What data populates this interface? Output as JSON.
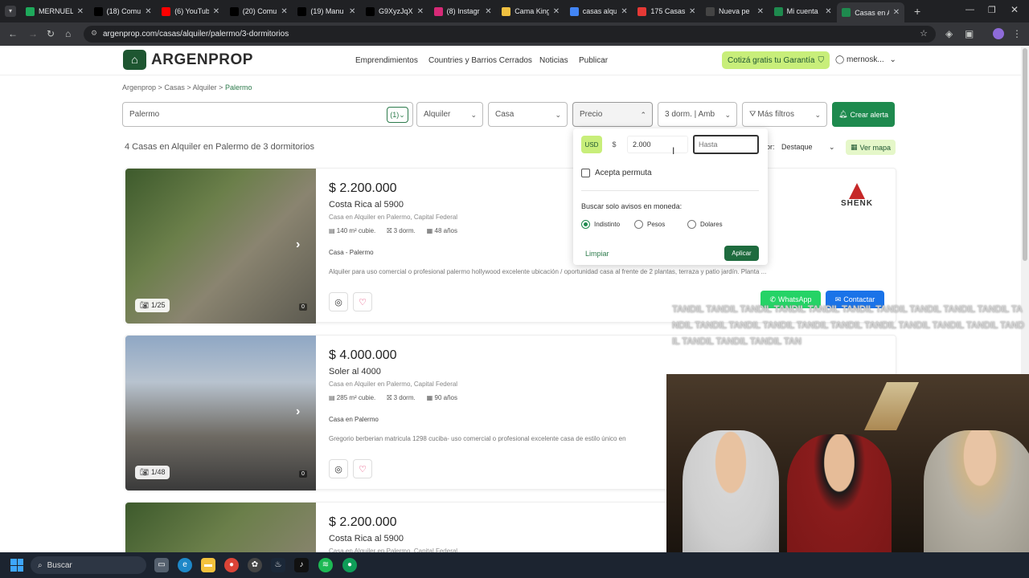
{
  "browser": {
    "tabs": [
      {
        "title": "MERNUEL",
        "icon": "mernuel-icon",
        "color": "#1ea95b"
      },
      {
        "title": "(18) Comu",
        "icon": "x-icon",
        "color": "#000000"
      },
      {
        "title": "(6) YouTub",
        "icon": "youtube-icon",
        "color": "#ff0000"
      },
      {
        "title": "(20) Comu",
        "icon": "x-icon",
        "color": "#000000"
      },
      {
        "title": "(19) Manu",
        "icon": "x-icon",
        "color": "#000000"
      },
      {
        "title": "G9XyzJqX",
        "icon": "x-icon",
        "color": "#000000"
      },
      {
        "title": "(8) Instagr",
        "icon": "instagram-icon",
        "color": "#d62976"
      },
      {
        "title": "Cama King",
        "icon": "bed-icon",
        "color": "#f0c040"
      },
      {
        "title": "casas alqu",
        "icon": "google-icon",
        "color": "#4285f4"
      },
      {
        "title": "175 Casas",
        "icon": "pin-icon",
        "color": "#e53935"
      },
      {
        "title": "Nueva pe",
        "icon": "openai-icon",
        "color": "#444444"
      },
      {
        "title": "Mi cuenta",
        "icon": "argenprop-icon",
        "color": "#1e8a4e"
      },
      {
        "title": "Casas en A",
        "icon": "argenprop-icon",
        "color": "#1e8a4e"
      }
    ],
    "url": "argenprop.com/casas/alquiler/palermo/3-dormitorios"
  },
  "site": {
    "logo": "ARGENPROP",
    "nav": [
      "Emprendimientos",
      "Countries y Barrios Cerrados",
      "Noticias",
      "Publicar"
    ],
    "cotiza": "Cotizá gratis tu Garantía",
    "user": "mernosk..."
  },
  "breadcrumb": {
    "items": [
      "Argenprop",
      "Casas",
      "Alquiler"
    ],
    "current": "Palermo",
    "sep": ">"
  },
  "filters": {
    "location": "Palermo",
    "location_count": "(1)",
    "operation": "Alquiler",
    "type": "Casa",
    "price": "Precio",
    "rooms": "3 dorm. | Amb",
    "more": "Más filtros",
    "alert": "Crear alerta"
  },
  "results": {
    "title": "4 Casas en Alquiler en Palermo de 3 dormitorios",
    "sort_label": "or:",
    "sort_value": "Destaque",
    "map": "Ver mapa"
  },
  "listings": [
    {
      "price": "$ 2.200.000",
      "address": "Costa Rica al 5900",
      "subtitle": "Casa en Alquiler en Palermo, Capital Federal",
      "area": "140 m² cubie.",
      "rooms": "3 dorm.",
      "age": "48 años",
      "ptype": "Casa - Palermo",
      "desc": "Alquiler para uso comercial o profesional palermo hollywood excelente ubicación / oportunidad casa al frente de 2 plantas, terraza y patio jardín. Planta ...",
      "photos": "1/25",
      "zero": "0",
      "brand": "SHENK",
      "whatsapp": "WhatsApp",
      "contact": "Contactar"
    },
    {
      "price": "$ 4.000.000",
      "address": "Soler al 4000",
      "subtitle": "Casa en Alquiler en Palermo, Capital Federal",
      "area": "285 m² cubie.",
      "rooms": "3 dorm.",
      "age": "90 años",
      "ptype": "Casa en Palermo",
      "desc": "Gregorio berberian matricula 1298 cuciba- uso comercial o profesional excelente casa de estilo único en",
      "photos": "1/48",
      "zero": "0"
    },
    {
      "price": "$ 2.200.000",
      "address": "Costa Rica al 5900",
      "subtitle": "Casa en Alquiler en Palermo, Capital Federal"
    }
  ],
  "price_popup": {
    "currency_usd": "USD",
    "currency_ars": "$",
    "from_value": "2.000",
    "to_placeholder": "Hasta",
    "permuta": "Acepta permuta",
    "currency_label": "Buscar solo avisos en moneda:",
    "options": [
      "Indistinto",
      "Pesos",
      "Dolares"
    ],
    "selected": "Indistinto",
    "clear": "Limpiar",
    "apply": "Aplicar"
  },
  "overlay": {
    "text": "TANDIL TANDIL TANDIL TANDIL TANDIL TANDIL TANDIL TANDIL TANDIL TANDIL TANDIL TANDIL TANDIL TANDIL TANDIL TANDIL TANDIL TANDIL TANDIL TANDIL TANDIL TANDIL TANDIL TANDIL TAN"
  },
  "taskbar": {
    "search": "Buscar"
  },
  "colors": {
    "brand_green": "#1e8a4e",
    "accent_lime": "#c8ee7a",
    "whatsapp": "#25d366",
    "contact_blue": "#1a73e8"
  }
}
